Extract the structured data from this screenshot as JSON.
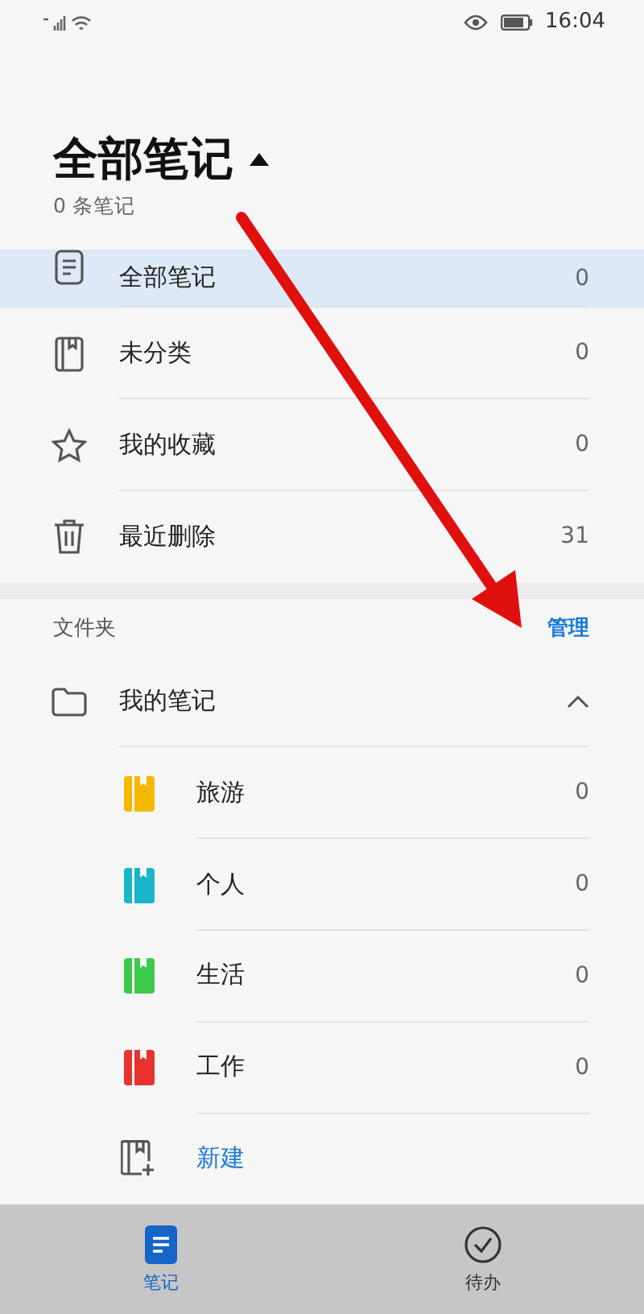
{
  "status_bar": {
    "time": "16:04"
  },
  "header": {
    "title": "全部笔记",
    "subtitle": "0 条笔记"
  },
  "categories": [
    {
      "kind": "notes",
      "label": "全部笔记",
      "count": "0",
      "selected": true
    },
    {
      "kind": "unsorted",
      "label": "未分类",
      "count": "0",
      "selected": false
    },
    {
      "kind": "favorites",
      "label": "我的收藏",
      "count": "0",
      "selected": false
    },
    {
      "kind": "trash",
      "label": "最近删除",
      "count": "31",
      "selected": false
    }
  ],
  "folders": {
    "label": "文件夹",
    "action": "管理",
    "folder": {
      "name": "我的笔记",
      "expanded": true,
      "children": [
        {
          "name": "旅游",
          "count": "0",
          "color": "#f5b800"
        },
        {
          "name": "个人",
          "count": "0",
          "color": "#1ab5c8"
        },
        {
          "name": "生活",
          "count": "0",
          "color": "#3ec94a"
        },
        {
          "name": "工作",
          "count": "0",
          "color": "#e8322e"
        }
      ]
    },
    "new_button": "新建"
  },
  "tabs": [
    {
      "kind": "notes",
      "label": "笔记",
      "selected": true
    },
    {
      "kind": "todo",
      "label": "待办",
      "selected": false
    }
  ]
}
